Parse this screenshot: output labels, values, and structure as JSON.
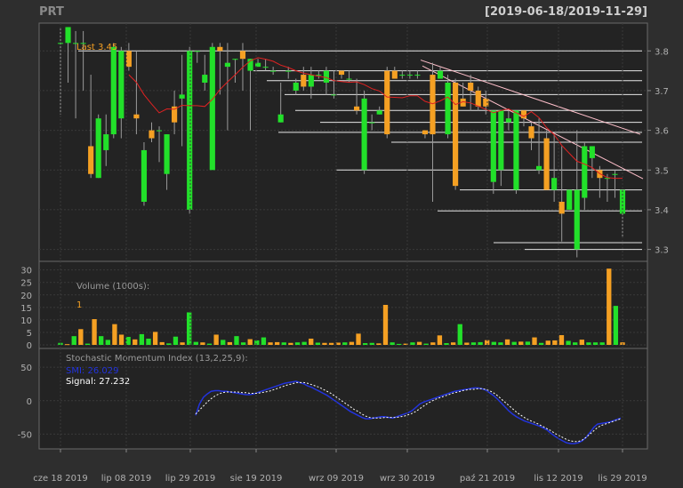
{
  "symbol": "PRT",
  "date_range": "[2019-06-18/2019-11-29]",
  "colors": {
    "background": "#2e2e2e",
    "panel": "#232323",
    "grid": "#3a3a3a",
    "up": "#22e02a",
    "down": "#f5a023",
    "wick": "#9a9a9a",
    "level_line": "#e6e6e6",
    "trend_line": "#ffc0cb",
    "ma": "#e02222",
    "smi": "#2233dd",
    "signal": "#ffffff",
    "axis_text": "#b0b0b0",
    "label_orange": "#f5a023"
  },
  "price_panel": {
    "last_label": "Last 3.45",
    "y_ticks": [
      "3.8",
      "3.7",
      "3.6",
      "3.5",
      "3.4",
      "3.3"
    ]
  },
  "volume_panel": {
    "title": "Volume (1000s):",
    "last_value": "1",
    "y_ticks": [
      "30",
      "25",
      "20",
      "15",
      "10",
      "5",
      "0"
    ]
  },
  "smi_panel": {
    "title": "Stochastic Momentum Index (13,2,25,9):",
    "smi_label": "SMI: 26.029",
    "signal_label": "Signal: 27.232",
    "y_ticks": [
      "50",
      "0",
      "-50"
    ]
  },
  "x_ticks": [
    "cze 18 2019",
    "lip 08 2019",
    "lip 29 2019",
    "sie 19 2019",
    "wrz 09 2019",
    "wrz 30 2019",
    "paź 21 2019",
    "lis 12 2019",
    "lis 29 2019"
  ],
  "chart_data": {
    "type": "candlestick",
    "title": "PRT",
    "ylim": [
      3.27,
      3.87
    ],
    "candles": [
      [
        3.82,
        3.86,
        3.64,
        3.82
      ],
      [
        3.82,
        3.86,
        3.72,
        3.86
      ],
      [
        3.82,
        3.85,
        3.63,
        3.82
      ],
      [
        3.82,
        3.85,
        3.7,
        3.82
      ],
      [
        3.56,
        3.74,
        3.48,
        3.49
      ],
      [
        3.48,
        3.64,
        3.48,
        3.63
      ],
      [
        3.55,
        3.64,
        3.51,
        3.59
      ],
      [
        3.59,
        3.82,
        3.58,
        3.81
      ],
      [
        3.63,
        3.81,
        3.58,
        3.8
      ],
      [
        3.8,
        3.82,
        3.75,
        3.76
      ],
      [
        3.64,
        3.8,
        3.59,
        3.63
      ],
      [
        3.42,
        3.57,
        3.41,
        3.55
      ],
      [
        3.6,
        3.62,
        3.57,
        3.58
      ],
      [
        3.6,
        3.61,
        3.52,
        3.6
      ],
      [
        3.49,
        3.59,
        3.45,
        3.59
      ],
      [
        3.66,
        3.7,
        3.59,
        3.62
      ],
      [
        3.68,
        3.79,
        3.56,
        3.69
      ],
      [
        3.4,
        3.81,
        3.39,
        3.8
      ],
      [
        3.8,
        3.8,
        3.77,
        3.8
      ],
      [
        3.72,
        3.79,
        3.7,
        3.74
      ],
      [
        3.5,
        3.82,
        3.6,
        3.81
      ],
      [
        3.81,
        3.82,
        3.69,
        3.8
      ],
      [
        3.76,
        3.82,
        3.6,
        3.77
      ],
      [
        3.78,
        3.78,
        3.72,
        3.78
      ],
      [
        3.8,
        3.82,
        3.7,
        3.78
      ],
      [
        3.75,
        3.78,
        3.6,
        3.78
      ],
      [
        3.76,
        3.78,
        3.76,
        3.77
      ],
      [
        3.76,
        3.78,
        3.75,
        3.76
      ],
      [
        3.75,
        3.76,
        3.74,
        3.75
      ],
      [
        3.62,
        3.72,
        3.62,
        3.64
      ],
      [
        3.75,
        3.76,
        3.73,
        3.75
      ],
      [
        3.7,
        3.73,
        3.69,
        3.72
      ],
      [
        3.74,
        3.76,
        3.7,
        3.71
      ],
      [
        3.71,
        3.76,
        3.68,
        3.74
      ],
      [
        3.74,
        3.75,
        3.73,
        3.74
      ],
      [
        3.72,
        3.76,
        3.69,
        3.75
      ],
      [
        3.69,
        3.75,
        3.68,
        3.69
      ],
      [
        3.75,
        3.75,
        3.73,
        3.74
      ],
      [
        3.73,
        3.75,
        3.72,
        3.73
      ],
      [
        3.66,
        3.73,
        3.64,
        3.65
      ],
      [
        3.5,
        3.7,
        3.49,
        3.68
      ],
      [
        3.62,
        3.64,
        3.6,
        3.62
      ],
      [
        3.64,
        3.66,
        3.64,
        3.65
      ],
      [
        3.75,
        3.76,
        3.58,
        3.59
      ],
      [
        3.75,
        3.76,
        3.73,
        3.73
      ],
      [
        3.74,
        3.75,
        3.73,
        3.74
      ],
      [
        3.74,
        3.75,
        3.73,
        3.74
      ],
      [
        3.74,
        3.75,
        3.73,
        3.74
      ],
      [
        3.6,
        3.6,
        3.58,
        3.59
      ],
      [
        3.74,
        3.77,
        3.42,
        3.59
      ],
      [
        3.73,
        3.76,
        3.73,
        3.75
      ],
      [
        3.59,
        3.74,
        3.58,
        3.72
      ],
      [
        3.72,
        3.73,
        3.45,
        3.46
      ],
      [
        3.68,
        3.72,
        3.66,
        3.66
      ],
      [
        3.72,
        3.74,
        3.65,
        3.7
      ],
      [
        3.7,
        3.71,
        3.65,
        3.66
      ],
      [
        3.68,
        3.7,
        3.64,
        3.66
      ],
      [
        3.47,
        3.62,
        3.44,
        3.65
      ],
      [
        3.5,
        3.65,
        3.46,
        3.65
      ],
      [
        3.62,
        3.65,
        3.6,
        3.63
      ],
      [
        3.45,
        3.65,
        3.44,
        3.65
      ],
      [
        3.65,
        3.65,
        3.61,
        3.63
      ],
      [
        3.61,
        3.62,
        3.55,
        3.58
      ],
      [
        3.5,
        3.63,
        3.49,
        3.51
      ],
      [
        3.58,
        3.6,
        3.45,
        3.45
      ],
      [
        3.45,
        3.59,
        3.42,
        3.48
      ],
      [
        3.42,
        3.56,
        3.32,
        3.39
      ],
      [
        3.4,
        3.45,
        3.4,
        3.45
      ],
      [
        3.3,
        3.6,
        3.28,
        3.45
      ],
      [
        3.43,
        3.57,
        3.4,
        3.56
      ],
      [
        3.53,
        3.56,
        3.48,
        3.56
      ],
      [
        3.5,
        3.51,
        3.43,
        3.48
      ],
      [
        3.48,
        3.49,
        3.42,
        3.48
      ],
      [
        3.49,
        3.5,
        3.43,
        3.49
      ],
      [
        3.39,
        3.45,
        3.33,
        3.45
      ]
    ],
    "volume": [
      0.8,
      0.3,
      3.5,
      6.3,
      0.5,
      10.3,
      3.5,
      2.0,
      8.3,
      4.1,
      3.2,
      2.2,
      4.3,
      2.5,
      5.2,
      1.1,
      0.6,
      3.3,
      1.0,
      13.0,
      1.2,
      1.0,
      0.5,
      4.1,
      2.0,
      1.1,
      3.5,
      1.0,
      2.3,
      1.8,
      3.0,
      1.0,
      1.1,
      1.0,
      0.8,
      1.0,
      1.2,
      2.5,
      0.9,
      0.8,
      0.8,
      0.9,
      1.0,
      1.2,
      4.5,
      0.7,
      0.8,
      0.6,
      16.0,
      1.0,
      0.4,
      0.5,
      1.0,
      1.2,
      0.5,
      1.0,
      3.8,
      0.7,
      1.0,
      8.3,
      0.9,
      1.0,
      1.1,
      1.9,
      1.2,
      1.0,
      2.2,
      1.2,
      1.3,
      1.3,
      3.0,
      0.8,
      1.7,
      1.8,
      3.9,
      1.6,
      1.0,
      2.1,
      1.0,
      1.0,
      1.0,
      30.5,
      15.6,
      1.0
    ],
    "volume_up": [
      1,
      0,
      1,
      0,
      1,
      0,
      1,
      1,
      0,
      0,
      1,
      0,
      1,
      1,
      0,
      0,
      1,
      1,
      0,
      1,
      1,
      0,
      1,
      0,
      1,
      0,
      1,
      1,
      0,
      1,
      1,
      0,
      0,
      1,
      0,
      1,
      1,
      0,
      1,
      0,
      0,
      0,
      1,
      0,
      0,
      1,
      1,
      0,
      0,
      1,
      1,
      0,
      1,
      0,
      1,
      0,
      0,
      1,
      0,
      1,
      0,
      1,
      1,
      0,
      1,
      1,
      0,
      1,
      0,
      1,
      0,
      1,
      0,
      0,
      0,
      1,
      1,
      0,
      1,
      1,
      1,
      0,
      1,
      0
    ],
    "smi": [
      [
        0,
        null
      ]
    ],
    "smi_line": [
      -22,
      -5,
      5,
      10,
      14,
      15,
      15,
      14,
      14,
      13,
      12,
      11,
      10,
      9,
      9,
      10,
      12,
      14,
      16,
      18,
      20,
      22,
      24,
      26,
      27,
      28,
      29,
      27,
      25,
      22,
      20,
      17,
      14,
      11,
      8,
      4,
      0,
      -4,
      -8,
      -12,
      -16,
      -19,
      -22,
      -25,
      -27,
      -27,
      -26,
      -25,
      -24,
      -24,
      -25,
      -26,
      -24,
      -22,
      -20,
      -18,
      -15,
      -10,
      -5,
      -2,
      0,
      2,
      4,
      6,
      8,
      10,
      12,
      14,
      15,
      16,
      17,
      18,
      19,
      19,
      18,
      16,
      12,
      8,
      3,
      -3,
      -9,
      -15,
      -20,
      -24,
      -27,
      -30,
      -32,
      -34,
      -36,
      -38,
      -41,
      -44,
      -49,
      -53,
      -57,
      -60,
      -63,
      -64,
      -64,
      -63,
      -60,
      -55,
      -48,
      -40,
      -35,
      -34,
      -33,
      -32,
      -30,
      -28,
      -26
    ],
    "signal_line": [
      -20,
      -14,
      -8,
      -2,
      3,
      7,
      10,
      12,
      13,
      13,
      13,
      13,
      12,
      12,
      11,
      11,
      11,
      12,
      13,
      14,
      16,
      18,
      20,
      22,
      24,
      25,
      27,
      27,
      27,
      26,
      24,
      22,
      20,
      17,
      14,
      11,
      7,
      3,
      -1,
      -5,
      -9,
      -13,
      -16,
      -20,
      -23,
      -25,
      -26,
      -26,
      -26,
      -25,
      -25,
      -25,
      -25,
      -24,
      -23,
      -21,
      -19,
      -16,
      -12,
      -8,
      -4,
      -1,
      2,
      4,
      6,
      8,
      10,
      12,
      13,
      15,
      16,
      17,
      17,
      18,
      18,
      17,
      15,
      12,
      8,
      3,
      -2,
      -7,
      -12,
      -17,
      -21,
      -25,
      -28,
      -31,
      -33,
      -36,
      -39,
      -42,
      -45,
      -49,
      -52,
      -55,
      -58,
      -60,
      -61,
      -61,
      -59,
      -55,
      -50,
      -45,
      -40,
      -37,
      -35,
      -33,
      -31,
      -29,
      -27
    ]
  }
}
